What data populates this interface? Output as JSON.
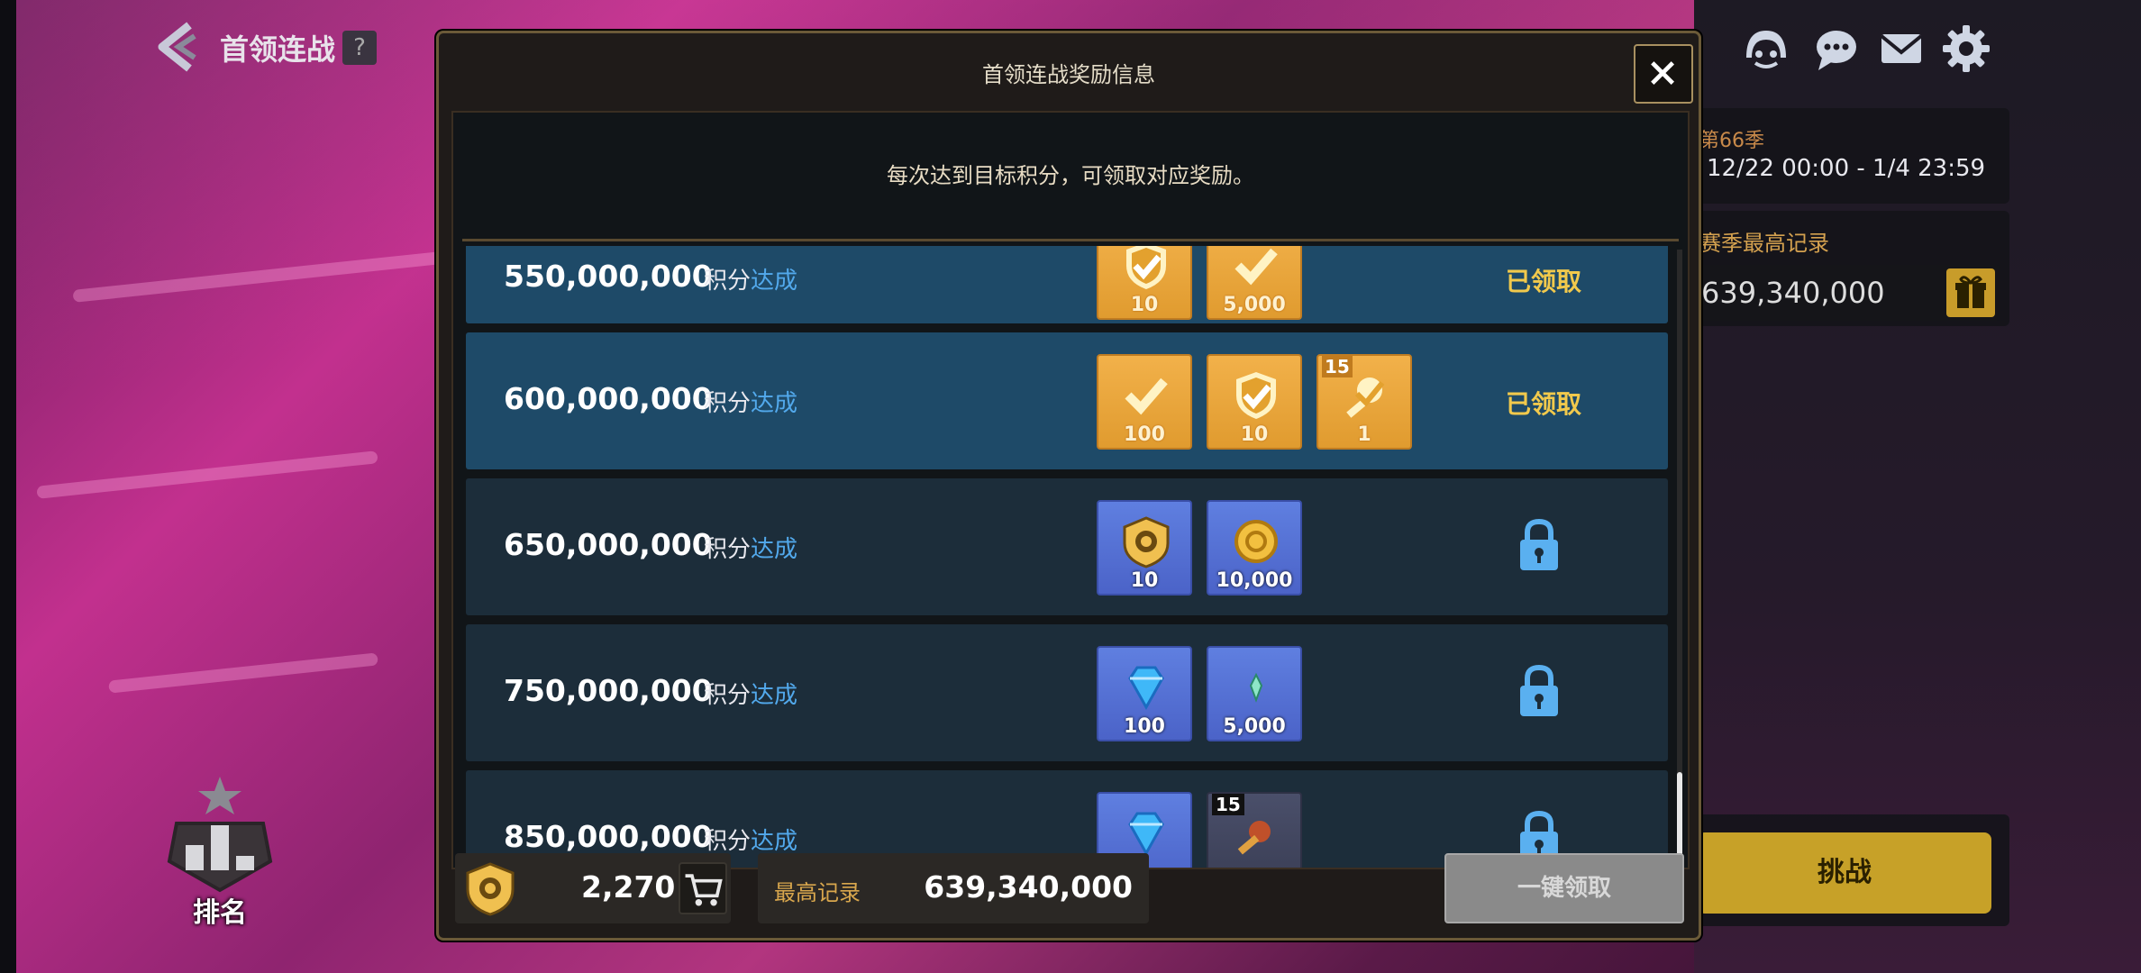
{
  "header": {
    "title": "首领连战",
    "help": "?"
  },
  "side_info": {
    "season_name": "第66季",
    "season_dates": "12/22 00:00 - 1/4 23:59",
    "record_label": "赛季最高记录",
    "record_value": "639,340,000",
    "challenge_label": "挑战"
  },
  "ranking": {
    "label": "排名"
  },
  "modal": {
    "title": "首领连战奖励信息",
    "description": "每次达到目标积分，可领取对应奖励。",
    "rows": [
      {
        "score": "550,000,000",
        "label_a": "积分",
        "label_b": "达成",
        "status": "已领取",
        "state": "claimed",
        "rewards": [
          {
            "icon": "gold-shield-check-icon",
            "qty": "10",
            "tier": ""
          },
          {
            "icon": "gold-check-icon",
            "qty": "5,000",
            "tier": ""
          }
        ]
      },
      {
        "score": "600,000,000",
        "label_a": "积分",
        "label_b": "达成",
        "status": "已领取",
        "state": "claimed",
        "rewards": [
          {
            "icon": "gold-check-icon",
            "qty": "100",
            "tier": ""
          },
          {
            "icon": "gold-shield-check-icon",
            "qty": "10",
            "tier": ""
          },
          {
            "icon": "gold-weapon-check-icon",
            "qty": "1",
            "tier": "15"
          }
        ]
      },
      {
        "score": "650,000,000",
        "label_a": "积分",
        "label_b": "达成",
        "status": "",
        "state": "locked",
        "rewards": [
          {
            "icon": "boss-shield-icon",
            "qty": "10",
            "tier": ""
          },
          {
            "icon": "gold-coin-icon",
            "qty": "10,000",
            "tier": ""
          }
        ]
      },
      {
        "score": "750,000,000",
        "label_a": "积分",
        "label_b": "达成",
        "status": "",
        "state": "locked",
        "rewards": [
          {
            "icon": "blue-diamond-icon",
            "qty": "100",
            "tier": ""
          },
          {
            "icon": "green-crystal-icon",
            "qty": "5,000",
            "tier": ""
          }
        ]
      },
      {
        "score": "850,000,000",
        "label_a": "积分",
        "label_b": "达成",
        "status": "",
        "state": "locked",
        "rewards": [
          {
            "icon": "blue-diamond-icon",
            "qty": "",
            "tier": ""
          },
          {
            "icon": "red-weapon-icon",
            "qty": "",
            "tier": "15"
          }
        ]
      }
    ],
    "footer": {
      "points_value": "2,270",
      "best_label": "最高记录",
      "best_value": "639,340,000",
      "claim_all_label": "一键领取"
    }
  },
  "colors": {
    "accent_gold": "#f1c94c",
    "link_blue": "#52a9ec",
    "claimed_row": "#1e4a68",
    "locked_row": "#1c2d3a"
  }
}
